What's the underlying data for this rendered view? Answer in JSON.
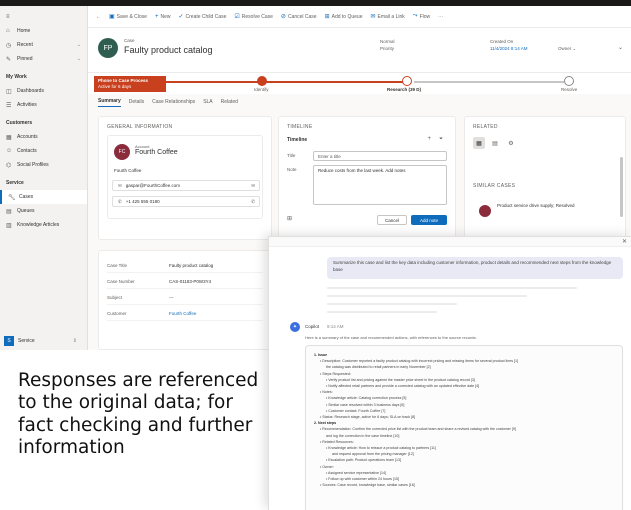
{
  "commandbar": {
    "items": [
      {
        "icon": "save-icon",
        "label": "Save & Close"
      },
      {
        "icon": "plus-icon",
        "label": "New"
      },
      {
        "icon": "check-icon",
        "label": "Create Child Case"
      },
      {
        "icon": "resolve-icon",
        "label": "Resolve Case"
      },
      {
        "icon": "cancel-icon",
        "label": "Cancel Case"
      },
      {
        "icon": "queue-icon",
        "label": "Add to Queue"
      },
      {
        "icon": "share-icon",
        "label": "Email a Link"
      },
      {
        "icon": "flow-icon",
        "label": "Flow"
      }
    ]
  },
  "sidebar": {
    "items": [
      {
        "icon": "menu-icon",
        "label": ""
      },
      {
        "icon": "home-icon",
        "label": "Home"
      },
      {
        "icon": "recent-icon",
        "label": "Recent"
      },
      {
        "icon": "pin-icon",
        "label": "Pinned"
      }
    ],
    "section1": "My Work",
    "work_items": [
      {
        "icon": "dashboard-icon",
        "label": "Dashboards"
      },
      {
        "icon": "activity-icon",
        "label": "Activities"
      }
    ],
    "section2": "Customers",
    "customer_items": [
      {
        "icon": "account-icon",
        "label": "Accounts"
      },
      {
        "icon": "contact-icon",
        "label": "Contacts"
      },
      {
        "icon": "social-icon",
        "label": "Social Profiles"
      }
    ],
    "section3": "Service",
    "service_items": [
      {
        "icon": "case-icon",
        "label": "Cases"
      },
      {
        "icon": "queue-icon",
        "label": "Queues"
      },
      {
        "icon": "knowledge-icon",
        "label": "Knowledge Articles"
      }
    ],
    "footer_badge": "S",
    "footer_label": "Service"
  },
  "record": {
    "avatar_initials": "FP",
    "kind": "Case",
    "title": "Faulty product catalog",
    "priority_label": "Priority",
    "priority_value": "Normal",
    "created_label": "Created On",
    "created_value": "11/4/2024 8:14 AM",
    "owner_label": "Owner"
  },
  "stages": {
    "active_box_title": "Phone to Case Process",
    "active_box_sub": "Active for 6 days",
    "labels": [
      "Identify",
      "Research (39 D)",
      "Resolve"
    ]
  },
  "tabs": [
    "Summary",
    "Details",
    "Case Relationships",
    "SLA",
    "Related"
  ],
  "general": {
    "title": "GENERAL INFORMATION",
    "contact_initials": "FC",
    "contact_kind": "Account",
    "contact_name": "Fourth Coffee",
    "contact_sub": "Fourth Coffee",
    "email": "gaspar@FourthCoffee.com",
    "phone": "+1 425 555 0180",
    "props": [
      {
        "k": "Case Title",
        "v": "Faulty product catalog",
        "link": false
      },
      {
        "k": "Case Number",
        "v": "CAS-01183-P0W3Y4",
        "link": false
      },
      {
        "k": "Subject",
        "v": "---",
        "link": false
      },
      {
        "k": "Customer",
        "v": "Fourth Coffee",
        "link": true
      }
    ]
  },
  "timeline": {
    "title": "TIMELINE",
    "header": "Timeline",
    "title_label": "Title",
    "title_value": "Enter a title",
    "note_label": "Note",
    "note_value": "Reduce costs from the last week. Add notes",
    "cancel": "Cancel",
    "add": "Add note"
  },
  "related": {
    "title": "RELATED",
    "similar_title": "SIMILAR CASES",
    "similar_case": "Product service drive supply; Resolved"
  },
  "copilot": {
    "user_prompt": "Summarize this case and list the key data including customer information, product details and recommended next steps from the knowledge base",
    "bot_name": "Copilot",
    "bot_time": "9:14 AM",
    "intro": "Here is a summary of the case and recommended actions, with references to the source records:",
    "lines": [
      {
        "level": "h",
        "text": "1. Issue"
      },
      {
        "level": "l1",
        "text": "• Description: Customer reported a faulty product catalog with incorrect pricing and missing items for several product lines [1]"
      },
      {
        "level": "l2",
        "text": "the catalog was distributed to retail partners in early November [2]"
      },
      {
        "level": "l1",
        "text": "• Steps Requested:"
      },
      {
        "level": "l2",
        "text": "• Verify product list and pricing against the master price sheet in the product catalog record [3]"
      },
      {
        "level": "l2",
        "text": "• Notify affected retail partners and provide a corrected catalog with an updated effective date [4]"
      },
      {
        "level": "l1",
        "text": "• Notes:"
      },
      {
        "level": "l2",
        "text": "• Knowledge article: Catalog correction process [5]"
      },
      {
        "level": "l2",
        "text": "• Similar case resolved within 3 business days [6]"
      },
      {
        "level": "l2",
        "text": "• Customer contact: Fourth Coffee [7]"
      },
      {
        "level": "l1",
        "text": "• Status: Research stage, active for 6 days; SLA on track [8]"
      },
      {
        "level": "h",
        "text": "2. Next steps"
      },
      {
        "level": "l1",
        "text": "• Recommendation: Confirm the corrected price list with the product team and share a revised catalog with the customer [9]"
      },
      {
        "level": "l2",
        "text": "and log the correction in the case timeline [10]"
      },
      {
        "level": "l1",
        "text": "• Related Resources:"
      },
      {
        "level": "l2",
        "text": "• Knowledge article: How to reissue a product catalog to partners [11]"
      },
      {
        "level": "l3",
        "text": "and request approval from the pricing manager [12]"
      },
      {
        "level": "l2",
        "text": "• Escalation path: Product operations team [13]"
      },
      {
        "level": "l1",
        "text": "• Owner:"
      },
      {
        "level": "l2",
        "text": "• Assigned service representative [14]"
      },
      {
        "level": "l2",
        "text": "• Follow up with customer within 24 hours [15]"
      },
      {
        "level": "l1",
        "text": "• Sources: Case record, knowledge base, similar cases [16]"
      }
    ]
  },
  "caption": "Responses are referenced to the original data; for fact checking and further information"
}
